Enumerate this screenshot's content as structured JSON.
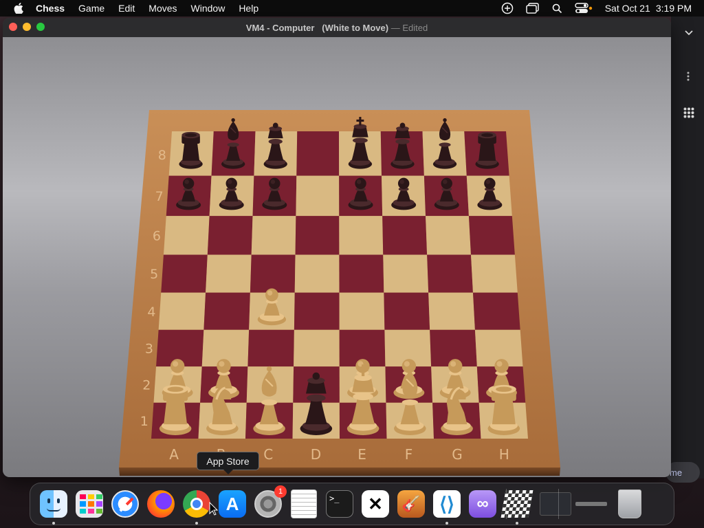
{
  "menubar": {
    "app_name": "Chess",
    "items": [
      "Game",
      "Edit",
      "Moves",
      "Window",
      "Help"
    ],
    "date": "Sat Oct 21",
    "time": "3:19 PM"
  },
  "window": {
    "title": "VM4 - Computer   (White to Move)",
    "separator": "—",
    "status": "Edited"
  },
  "board": {
    "files": [
      "A",
      "B",
      "C",
      "D",
      "E",
      "F",
      "G",
      "H"
    ],
    "ranks": [
      "8",
      "7",
      "6",
      "5",
      "4",
      "3",
      "2",
      "1"
    ],
    "light_square_color": "#d9b982",
    "dark_square_color": "#7a2030",
    "pieces": [
      {
        "square": "a8",
        "color": "black",
        "type": "rook"
      },
      {
        "square": "b8",
        "color": "black",
        "type": "bishop"
      },
      {
        "square": "c8",
        "color": "black",
        "type": "queen"
      },
      {
        "square": "e8",
        "color": "black",
        "type": "king"
      },
      {
        "square": "f8",
        "color": "black",
        "type": "queen"
      },
      {
        "square": "g8",
        "color": "black",
        "type": "bishop"
      },
      {
        "square": "h8",
        "color": "black",
        "type": "rook"
      },
      {
        "square": "a7",
        "color": "black",
        "type": "pawn"
      },
      {
        "square": "b7",
        "color": "black",
        "type": "pawn"
      },
      {
        "square": "c7",
        "color": "black",
        "type": "pawn"
      },
      {
        "square": "e7",
        "color": "black",
        "type": "pawn"
      },
      {
        "square": "f7",
        "color": "black",
        "type": "pawn"
      },
      {
        "square": "g7",
        "color": "black",
        "type": "pawn"
      },
      {
        "square": "h7",
        "color": "black",
        "type": "pawn"
      },
      {
        "square": "c4",
        "color": "white",
        "type": "pawn"
      },
      {
        "square": "a2",
        "color": "white",
        "type": "pawn"
      },
      {
        "square": "b2",
        "color": "white",
        "type": "pawn"
      },
      {
        "square": "e2",
        "color": "white",
        "type": "pawn"
      },
      {
        "square": "f2",
        "color": "white",
        "type": "pawn"
      },
      {
        "square": "g2",
        "color": "white",
        "type": "pawn"
      },
      {
        "square": "h2",
        "color": "white",
        "type": "pawn"
      },
      {
        "square": "a1",
        "color": "white",
        "type": "rook"
      },
      {
        "square": "b1",
        "color": "white",
        "type": "knight"
      },
      {
        "square": "c1",
        "color": "white",
        "type": "bishop"
      },
      {
        "square": "d1",
        "color": "black",
        "type": "queen"
      },
      {
        "square": "e1",
        "color": "white",
        "type": "king"
      },
      {
        "square": "f1",
        "color": "white",
        "type": "bishop"
      },
      {
        "square": "g1",
        "color": "white",
        "type": "knight"
      },
      {
        "square": "h1",
        "color": "white",
        "type": "rook"
      }
    ]
  },
  "tooltip": {
    "label": "App Store"
  },
  "sidepanel": {
    "pill_label": "me"
  },
  "dock": {
    "items": [
      {
        "name": "finder",
        "running": true
      },
      {
        "name": "launchpad",
        "running": false
      },
      {
        "name": "safari",
        "running": false
      },
      {
        "name": "firefox",
        "running": false
      },
      {
        "name": "chrome",
        "running": true
      },
      {
        "name": "app-store",
        "running": false
      },
      {
        "name": "system-settings",
        "running": false,
        "badge": "1"
      },
      {
        "name": "textedit",
        "running": false
      },
      {
        "name": "terminal",
        "running": false
      },
      {
        "name": "capcut",
        "running": false
      },
      {
        "name": "garageband",
        "running": false
      },
      {
        "name": "vscode",
        "running": true
      },
      {
        "name": "visual-studio",
        "running": false
      },
      {
        "name": "chess",
        "running": true
      },
      {
        "name": "window-preview",
        "running": false
      },
      {
        "name": "window-preview-2",
        "running": false
      },
      {
        "name": "trash",
        "running": false
      }
    ]
  }
}
